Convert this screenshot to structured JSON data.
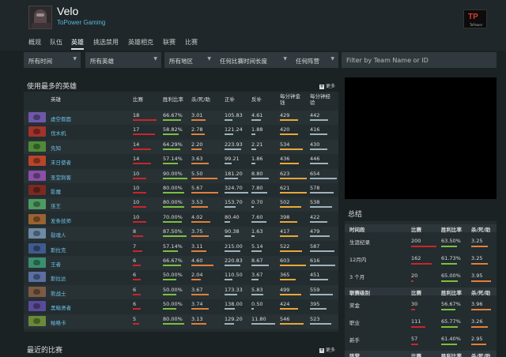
{
  "player": {
    "name": "Velo",
    "team": "ToPower Gaming"
  },
  "team_logo": {
    "text": "TP",
    "subtext": "ToPower"
  },
  "tabs": [
    "概观",
    "队伍",
    "英雄",
    "挑选禁用",
    "英雄相克",
    "联赛",
    "比赛"
  ],
  "active_tab": 2,
  "filters": {
    "time": "所有时间",
    "hero": "所有英雄",
    "region": "所有地区",
    "duration": "任何比赛时间长度",
    "faction": "任何阵营",
    "search_placeholder": "Filter by Team Name or ID"
  },
  "heroes_section": {
    "title": "使用最多的英雄",
    "more": "更多",
    "headers": {
      "hero": "英雄",
      "matches": "比赛",
      "winrate": "胜利比率",
      "kda": "杀/死/助",
      "lasthits": "正补",
      "denies": "反补",
      "gpm": "每分钟金钱",
      "xpm": "每分钟经验"
    }
  },
  "heroes": [
    {
      "name": "虚空假面",
      "icon": "faceless-void-icon",
      "color": "#6f58a8",
      "matches": "18",
      "winrate": "66.67%",
      "kda": "3.01",
      "lasthits": "105.83",
      "denies": "4.61",
      "gpm": "429",
      "xpm": "442"
    },
    {
      "name": "伐木机",
      "icon": "timbersaw-icon",
      "color": "#a0332a",
      "matches": "17",
      "winrate": "58.82%",
      "kda": "2.78",
      "lasthits": "121.24",
      "denies": "1.88",
      "gpm": "420",
      "xpm": "416"
    },
    {
      "name": "先知",
      "icon": "natures-prophet-icon",
      "color": "#4f8a39",
      "matches": "14",
      "winrate": "64.29%",
      "kda": "2.20",
      "lasthits": "223.93",
      "denies": "2.21",
      "gpm": "534",
      "xpm": "430"
    },
    {
      "name": "末日使者",
      "icon": "doom-icon",
      "color": "#b8452a",
      "matches": "14",
      "winrate": "57.14%",
      "kda": "3.63",
      "lasthits": "99.21",
      "denies": "1.86",
      "gpm": "436",
      "xpm": "446"
    },
    {
      "name": "圣堂刺客",
      "icon": "templar-assassin-icon",
      "color": "#8a4fa6",
      "matches": "10",
      "winrate": "90.00%",
      "kda": "5.50",
      "lasthits": "181.20",
      "denies": "8.80",
      "gpm": "623",
      "xpm": "654"
    },
    {
      "name": "影魔",
      "icon": "shadow-fiend-icon",
      "color": "#7a2a22",
      "matches": "10",
      "winrate": "80.00%",
      "kda": "5.67",
      "lasthits": "324.70",
      "denies": "7.80",
      "gpm": "621",
      "xpm": "578"
    },
    {
      "name": "巫王",
      "icon": "wraith-king-icon",
      "color": "#4e9b62",
      "matches": "10",
      "winrate": "80.00%",
      "kda": "3.53",
      "lasthits": "153.70",
      "denies": "0.70",
      "gpm": "502",
      "xpm": "538"
    },
    {
      "name": "发条技师",
      "icon": "clockwerk-icon",
      "color": "#9a6232",
      "matches": "10",
      "winrate": "70.00%",
      "kda": "4.02",
      "lasthits": "80.40",
      "denies": "7.60",
      "gpm": "398",
      "xpm": "422"
    },
    {
      "name": "裂魂人",
      "icon": "spirit-breaker-icon",
      "color": "#6d8aa6",
      "matches": "8",
      "winrate": "87.50%",
      "kda": "3.75",
      "lasthits": "90.38",
      "denies": "1.63",
      "gpm": "417",
      "xpm": "479"
    },
    {
      "name": "斯拉克",
      "icon": "slark-icon",
      "color": "#3f5a8c",
      "matches": "7",
      "winrate": "57.14%",
      "kda": "3.11",
      "lasthits": "215.00",
      "denies": "5.14",
      "gpm": "522",
      "xpm": "587"
    },
    {
      "name": "王者",
      "icon": "tiny-icon",
      "color": "#3b8f6e",
      "matches": "6",
      "winrate": "66.67%",
      "kda": "4.60",
      "lasthits": "220.83",
      "denies": "8.67",
      "gpm": "603",
      "xpm": "616"
    },
    {
      "name": "斯拉达",
      "icon": "slardar-icon",
      "color": "#5a6fa0",
      "matches": "6",
      "winrate": "50.00%",
      "kda": "2.04",
      "lasthits": "110.50",
      "denies": "3.67",
      "gpm": "365",
      "xpm": "451"
    },
    {
      "name": "熊战士",
      "icon": "ursa-icon",
      "color": "#7d5a44",
      "matches": "6",
      "winrate": "50.00%",
      "kda": "3.67",
      "lasthits": "173.33",
      "denies": "5.83",
      "gpm": "499",
      "xpm": "559"
    },
    {
      "name": "黑暗贤者",
      "icon": "dark-seer-icon",
      "color": "#5a4a9a",
      "matches": "6",
      "winrate": "50.00%",
      "kda": "3.74",
      "lasthits": "138.00",
      "denies": "0.50",
      "gpm": "424",
      "xpm": "395"
    },
    {
      "name": "帕格卡",
      "icon": "pugna-icon",
      "color": "#6a8a3a",
      "matches": "5",
      "winrate": "80.00%",
      "kda": "3.13",
      "lasthits": "129.20",
      "denies": "11.80",
      "gpm": "546",
      "xpm": "523"
    }
  ],
  "summary": {
    "title": "总结",
    "sections": [
      {
        "headers": [
          "时间段",
          "比赛",
          "胜利比率",
          "杀/死/助"
        ],
        "rows": [
          {
            "label": "生涯纪录",
            "matches": "200",
            "winrate": "63.50%",
            "kda": "3.25"
          },
          {
            "label": "12月内",
            "matches": "162",
            "winrate": "61.73%",
            "kda": "3.25"
          },
          {
            "label": "3 个月",
            "matches": "20",
            "winrate": "65.00%",
            "kda": "3.95"
          }
        ]
      },
      {
        "headers": [
          "联赛级别",
          "比赛",
          "胜利比率",
          "杀/死/助"
        ],
        "rows": [
          {
            "label": "奖金",
            "matches": "30",
            "winrate": "56.67%",
            "kda": "3.96"
          },
          {
            "label": "职业",
            "matches": "111",
            "winrate": "65.77%",
            "kda": "3.26"
          },
          {
            "label": "新手",
            "matches": "57",
            "winrate": "61.40%",
            "kda": "2.95"
          }
        ]
      },
      {
        "headers": [
          "阵营",
          "比赛",
          "胜利比率",
          "杀/死/助"
        ],
        "rows": []
      }
    ]
  },
  "recent_section": {
    "title": "最近的比赛",
    "more": "更多"
  },
  "colors": {
    "matches_bar": "#c8262b",
    "winrate_bar": "#7bbf3f",
    "kda_bar": "#e0803a",
    "lasthits_bar": "#9fb3bd",
    "denies_bar": "#9fb3bd",
    "gpm_bar": "#e8a838",
    "xpm_bar": "#9fb3bd",
    "link": "#6cc2e6"
  }
}
